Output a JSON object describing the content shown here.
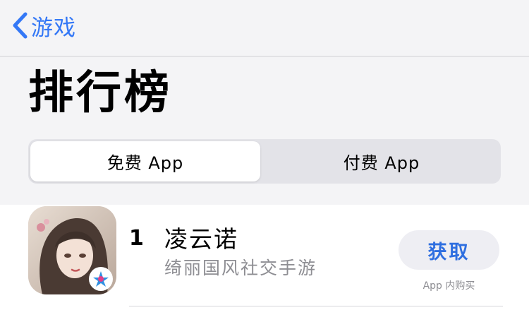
{
  "nav": {
    "back_label": "游戏",
    "back_icon": "chevron-left-icon"
  },
  "header": {
    "title": "排行榜"
  },
  "segmented_control": {
    "options": [
      "免费 App",
      "付费 App"
    ],
    "selected": "免费 App"
  },
  "apps": [
    {
      "rank": "1",
      "name": "凌云诺",
      "subtitle": "绮丽国风社交手游",
      "action_label": "获取",
      "note": "App 内购买"
    }
  ],
  "colors": {
    "accent": "#3478f6",
    "background": "#f4f4f6",
    "secondary_text": "#8e8e93",
    "button_bg": "#eeeef3"
  }
}
